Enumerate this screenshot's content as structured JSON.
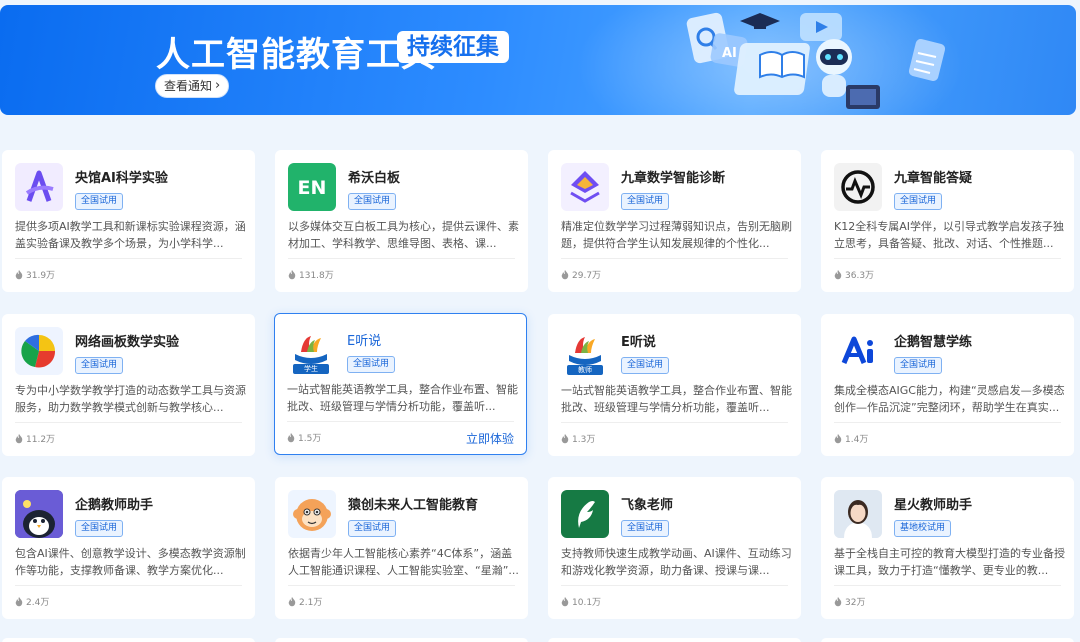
{
  "banner": {
    "title": "人工智能教育工具",
    "tag": "持续征集",
    "button_label": "查看通知",
    "chevron_icon": "chevron-right-icon"
  },
  "colors": {
    "accent": "#1a66d8",
    "banner": "#1670ee"
  },
  "cards": [
    {
      "title": "央馆AI科学实验",
      "badge": "全国试用",
      "desc": "提供多项AI教学工具和新课标实验课程资源，涵盖实验备课及教学多个场景，为小学科学...",
      "heat": "31.9万",
      "icon": "letter-a-logo"
    },
    {
      "title": "希沃白板",
      "badge": "全国试用",
      "desc": "以多媒体交互白板工具为核心，提供云课件、素材加工、学科教学、思维导图、表格、课...",
      "heat": "131.8万",
      "icon": "en-logo"
    },
    {
      "title": "九章数学智能诊断",
      "badge": "全国试用",
      "desc": "精准定位数学学习过程薄弱知识点，告别无脑刷题，提供符合学生认知发展规律的个性化...",
      "heat": "29.7万",
      "icon": "diamond-logo"
    },
    {
      "title": "九章智能答疑",
      "badge": "全国试用",
      "desc": "K12全科专属AI学伴，以引导式教学启发孩子独立思考，具备答疑、批改、对话、个性推题...",
      "heat": "36.3万",
      "icon": "wave-logo"
    },
    {
      "title": "网络画板数学实验",
      "badge": "全国试用",
      "desc": "专为中小学数学教学打造的动态数学工具与资源服务，助力数学教学模式创新与教学核心...",
      "heat": "11.2万",
      "icon": "pie-logo"
    },
    {
      "title": "E听说",
      "badge": "全国试用",
      "desc": "一站式智能英语教学工具，整合作业布置、智能批改、班级管理与学情分析功能，覆盖听...",
      "heat": "1.5万",
      "icon": "ear-student-logo",
      "logo_caption": "学生",
      "action": "立即体验"
    },
    {
      "title": "E听说",
      "badge": "全国试用",
      "desc": "一站式智能英语教学工具，整合作业布置、智能批改、班级管理与学情分析功能，覆盖听...",
      "heat": "1.3万",
      "icon": "ear-teacher-logo",
      "logo_caption": "教师"
    },
    {
      "title": "企鹅智慧学练",
      "badge": "全国试用",
      "desc": "集成全模态AIGC能力，构建“灵感启发—多模态创作—作品沉淀”完整闭环，帮助学生在真实...",
      "heat": "1.4万",
      "icon": "ai-logo"
    },
    {
      "title": "企鹅教师助手",
      "badge": "全国试用",
      "desc": "包含AI课件、创意教学设计、多模态教学资源制作等功能，支撑教师备课、教学方案优化...",
      "heat": "2.4万",
      "icon": "penguin-logo"
    },
    {
      "title": "猿创未来人工智能教育",
      "badge": "全国试用",
      "desc": "依据青少年人工智能核心素养“4C体系”，涵盖人工智能通识课程、人工智能实验室、“星瀚”...",
      "heat": "2.1万",
      "icon": "monkey-logo"
    },
    {
      "title": "飞象老师",
      "badge": "全国试用",
      "desc": "支持教师快速生成教学动画、AI课件、互动练习和游戏化教学资源，助力备课、授课与课...",
      "heat": "10.1万",
      "icon": "leaf-logo"
    },
    {
      "title": "星火教师助手",
      "badge": "基地校试用",
      "desc": "基于全栈自主可控的教育大模型打造的专业备授课工具，致力于打造“懂教学、更专业的教...",
      "heat": "32万",
      "icon": "avatar-logo"
    }
  ]
}
